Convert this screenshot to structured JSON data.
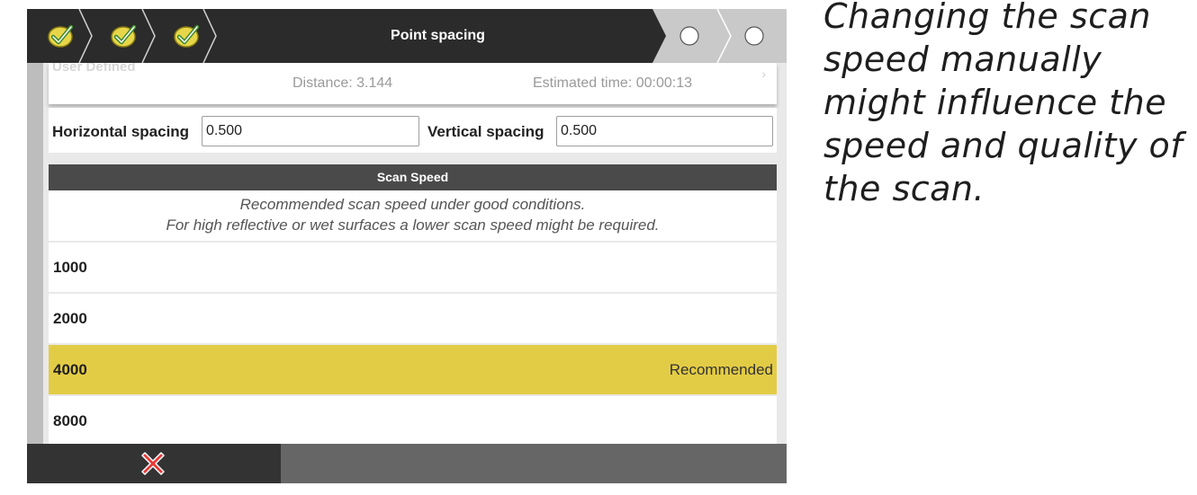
{
  "wizard": {
    "title": "Point spacing",
    "completed_steps": [
      "check-icon",
      "check-icon",
      "check-icon"
    ],
    "pending_steps": [
      "circle-icon",
      "circle-icon"
    ]
  },
  "summary": {
    "preset_name": "User Defined",
    "distance": "Distance: 3.144",
    "estimated_time": "Estimated time: 00:00:13"
  },
  "spacing": {
    "horizontal_label": "Horizontal spacing",
    "horizontal_value": "0.500",
    "vertical_label": "Vertical spacing",
    "vertical_value": "0.500"
  },
  "scan_speed": {
    "header": "Scan Speed",
    "note_line1": "Recommended scan speed under good conditions.",
    "note_line2": "For high reflective or wet surfaces a lower scan speed might be required.",
    "options": [
      {
        "value": "1000",
        "tag": ""
      },
      {
        "value": "2000",
        "tag": ""
      },
      {
        "value": "4000",
        "tag": "Recommended",
        "selected": true
      },
      {
        "value": "8000",
        "tag": ""
      }
    ]
  },
  "footer": {
    "cancel_icon": "close-x-icon"
  },
  "colors": {
    "selected": "#e3cc45",
    "header_dark": "#2b2b2b",
    "check_green": "#4caf50"
  },
  "caption": "Changing the scan speed manually might influence the speed and quality of the scan."
}
